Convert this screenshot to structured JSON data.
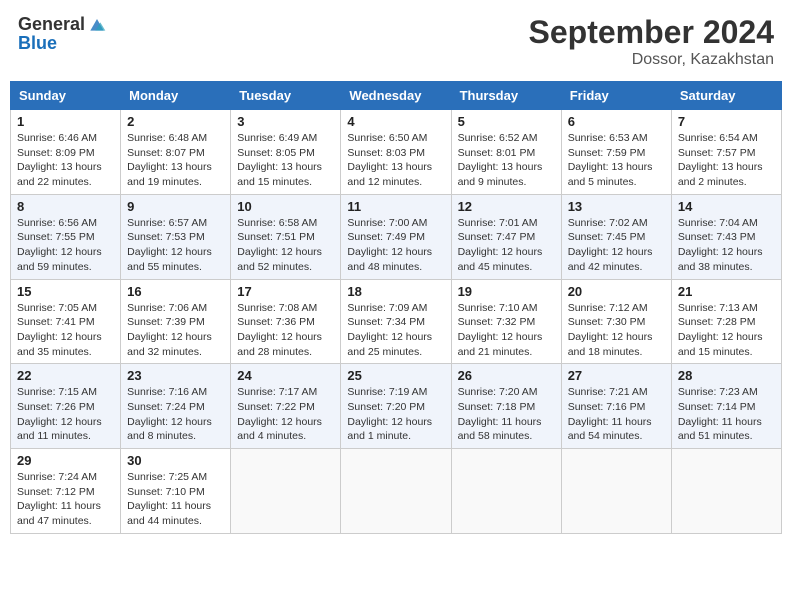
{
  "header": {
    "logo_general": "General",
    "logo_blue": "Blue",
    "month_title": "September 2024",
    "location": "Dossor, Kazakhstan"
  },
  "weekdays": [
    "Sunday",
    "Monday",
    "Tuesday",
    "Wednesday",
    "Thursday",
    "Friday",
    "Saturday"
  ],
  "weeks": [
    [
      {
        "day": "1",
        "sunrise": "Sunrise: 6:46 AM",
        "sunset": "Sunset: 8:09 PM",
        "daylight": "Daylight: 13 hours and 22 minutes."
      },
      {
        "day": "2",
        "sunrise": "Sunrise: 6:48 AM",
        "sunset": "Sunset: 8:07 PM",
        "daylight": "Daylight: 13 hours and 19 minutes."
      },
      {
        "day": "3",
        "sunrise": "Sunrise: 6:49 AM",
        "sunset": "Sunset: 8:05 PM",
        "daylight": "Daylight: 13 hours and 15 minutes."
      },
      {
        "day": "4",
        "sunrise": "Sunrise: 6:50 AM",
        "sunset": "Sunset: 8:03 PM",
        "daylight": "Daylight: 13 hours and 12 minutes."
      },
      {
        "day": "5",
        "sunrise": "Sunrise: 6:52 AM",
        "sunset": "Sunset: 8:01 PM",
        "daylight": "Daylight: 13 hours and 9 minutes."
      },
      {
        "day": "6",
        "sunrise": "Sunrise: 6:53 AM",
        "sunset": "Sunset: 7:59 PM",
        "daylight": "Daylight: 13 hours and 5 minutes."
      },
      {
        "day": "7",
        "sunrise": "Sunrise: 6:54 AM",
        "sunset": "Sunset: 7:57 PM",
        "daylight": "Daylight: 13 hours and 2 minutes."
      }
    ],
    [
      {
        "day": "8",
        "sunrise": "Sunrise: 6:56 AM",
        "sunset": "Sunset: 7:55 PM",
        "daylight": "Daylight: 12 hours and 59 minutes."
      },
      {
        "day": "9",
        "sunrise": "Sunrise: 6:57 AM",
        "sunset": "Sunset: 7:53 PM",
        "daylight": "Daylight: 12 hours and 55 minutes."
      },
      {
        "day": "10",
        "sunrise": "Sunrise: 6:58 AM",
        "sunset": "Sunset: 7:51 PM",
        "daylight": "Daylight: 12 hours and 52 minutes."
      },
      {
        "day": "11",
        "sunrise": "Sunrise: 7:00 AM",
        "sunset": "Sunset: 7:49 PM",
        "daylight": "Daylight: 12 hours and 48 minutes."
      },
      {
        "day": "12",
        "sunrise": "Sunrise: 7:01 AM",
        "sunset": "Sunset: 7:47 PM",
        "daylight": "Daylight: 12 hours and 45 minutes."
      },
      {
        "day": "13",
        "sunrise": "Sunrise: 7:02 AM",
        "sunset": "Sunset: 7:45 PM",
        "daylight": "Daylight: 12 hours and 42 minutes."
      },
      {
        "day": "14",
        "sunrise": "Sunrise: 7:04 AM",
        "sunset": "Sunset: 7:43 PM",
        "daylight": "Daylight: 12 hours and 38 minutes."
      }
    ],
    [
      {
        "day": "15",
        "sunrise": "Sunrise: 7:05 AM",
        "sunset": "Sunset: 7:41 PM",
        "daylight": "Daylight: 12 hours and 35 minutes."
      },
      {
        "day": "16",
        "sunrise": "Sunrise: 7:06 AM",
        "sunset": "Sunset: 7:39 PM",
        "daylight": "Daylight: 12 hours and 32 minutes."
      },
      {
        "day": "17",
        "sunrise": "Sunrise: 7:08 AM",
        "sunset": "Sunset: 7:36 PM",
        "daylight": "Daylight: 12 hours and 28 minutes."
      },
      {
        "day": "18",
        "sunrise": "Sunrise: 7:09 AM",
        "sunset": "Sunset: 7:34 PM",
        "daylight": "Daylight: 12 hours and 25 minutes."
      },
      {
        "day": "19",
        "sunrise": "Sunrise: 7:10 AM",
        "sunset": "Sunset: 7:32 PM",
        "daylight": "Daylight: 12 hours and 21 minutes."
      },
      {
        "day": "20",
        "sunrise": "Sunrise: 7:12 AM",
        "sunset": "Sunset: 7:30 PM",
        "daylight": "Daylight: 12 hours and 18 minutes."
      },
      {
        "day": "21",
        "sunrise": "Sunrise: 7:13 AM",
        "sunset": "Sunset: 7:28 PM",
        "daylight": "Daylight: 12 hours and 15 minutes."
      }
    ],
    [
      {
        "day": "22",
        "sunrise": "Sunrise: 7:15 AM",
        "sunset": "Sunset: 7:26 PM",
        "daylight": "Daylight: 12 hours and 11 minutes."
      },
      {
        "day": "23",
        "sunrise": "Sunrise: 7:16 AM",
        "sunset": "Sunset: 7:24 PM",
        "daylight": "Daylight: 12 hours and 8 minutes."
      },
      {
        "day": "24",
        "sunrise": "Sunrise: 7:17 AM",
        "sunset": "Sunset: 7:22 PM",
        "daylight": "Daylight: 12 hours and 4 minutes."
      },
      {
        "day": "25",
        "sunrise": "Sunrise: 7:19 AM",
        "sunset": "Sunset: 7:20 PM",
        "daylight": "Daylight: 12 hours and 1 minute."
      },
      {
        "day": "26",
        "sunrise": "Sunrise: 7:20 AM",
        "sunset": "Sunset: 7:18 PM",
        "daylight": "Daylight: 11 hours and 58 minutes."
      },
      {
        "day": "27",
        "sunrise": "Sunrise: 7:21 AM",
        "sunset": "Sunset: 7:16 PM",
        "daylight": "Daylight: 11 hours and 54 minutes."
      },
      {
        "day": "28",
        "sunrise": "Sunrise: 7:23 AM",
        "sunset": "Sunset: 7:14 PM",
        "daylight": "Daylight: 11 hours and 51 minutes."
      }
    ],
    [
      {
        "day": "29",
        "sunrise": "Sunrise: 7:24 AM",
        "sunset": "Sunset: 7:12 PM",
        "daylight": "Daylight: 11 hours and 47 minutes."
      },
      {
        "day": "30",
        "sunrise": "Sunrise: 7:25 AM",
        "sunset": "Sunset: 7:10 PM",
        "daylight": "Daylight: 11 hours and 44 minutes."
      },
      {
        "day": "",
        "sunrise": "",
        "sunset": "",
        "daylight": ""
      },
      {
        "day": "",
        "sunrise": "",
        "sunset": "",
        "daylight": ""
      },
      {
        "day": "",
        "sunrise": "",
        "sunset": "",
        "daylight": ""
      },
      {
        "day": "",
        "sunrise": "",
        "sunset": "",
        "daylight": ""
      },
      {
        "day": "",
        "sunrise": "",
        "sunset": "",
        "daylight": ""
      }
    ]
  ]
}
